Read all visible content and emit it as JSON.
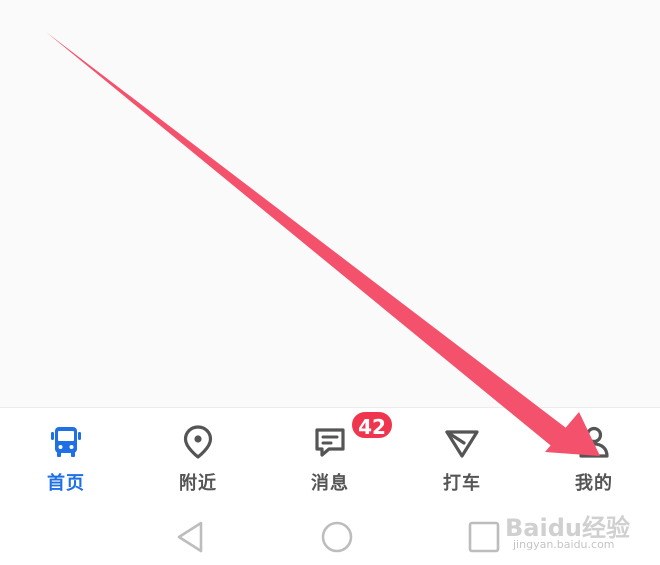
{
  "tabs": [
    {
      "label": "首页",
      "icon": "bus-icon",
      "active": true
    },
    {
      "label": "附近",
      "icon": "location-pin-icon",
      "active": false
    },
    {
      "label": "消息",
      "icon": "message-icon",
      "active": false,
      "badge": "42"
    },
    {
      "label": "打车",
      "icon": "taxi-paper-plane-icon",
      "active": false
    },
    {
      "label": "我的",
      "icon": "user-icon",
      "active": false
    }
  ],
  "colors": {
    "active": "#1f6fe5",
    "inactive": "#555555",
    "badge": "#f0364e",
    "annotation_arrow": "#f4516c"
  },
  "system_nav": {
    "back": "back-triangle-icon",
    "home": "home-circle-icon",
    "recents": "recents-square-icon"
  },
  "watermark": {
    "main": "Baidu经验",
    "sub": "jingyan.baidu.com"
  }
}
